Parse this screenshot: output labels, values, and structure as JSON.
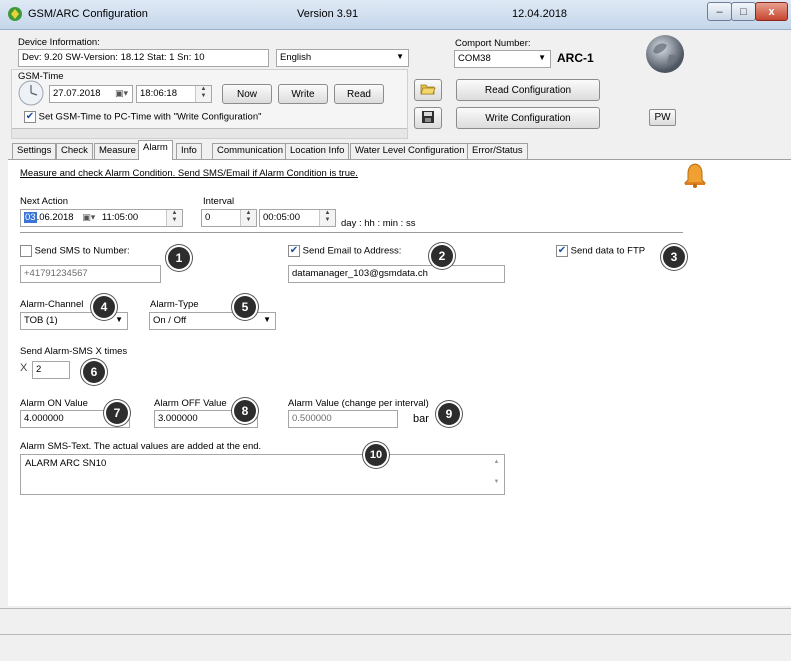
{
  "window": {
    "title": "GSM/ARC Configuration",
    "version": "Version 3.91",
    "date": "12.04.2018"
  },
  "device": {
    "label": "Device Information:",
    "info": "Dev: 9.20 SW-Version: 18.12 Stat: 1  Sn: 10",
    "language": "English"
  },
  "comport": {
    "label": "Comport Number:",
    "value": "COM38",
    "name": "ARC-1"
  },
  "gsm_time": {
    "label": "GSM-Time",
    "date": "27.07.2018",
    "time": "18:06:18",
    "now_label": "Now",
    "write_label": "Write",
    "read_label": "Read",
    "sync_label": "Set GSM-Time to PC-Time with \"Write Configuration\""
  },
  "config": {
    "read_label": "Read Configuration",
    "write_label": "Write Configuration",
    "pw_label": "PW"
  },
  "tabs": [
    {
      "label": "Settings"
    },
    {
      "label": "Check"
    },
    {
      "label": "Measure"
    },
    {
      "label": "Alarm"
    },
    {
      "label": "Info"
    },
    {
      "label": "Communication"
    },
    {
      "label": "Location Info"
    },
    {
      "label": "Water Level Configuration"
    },
    {
      "label": "Error/Status"
    }
  ],
  "alarm": {
    "description": "Measure and check Alarm Condition. Send SMS/Email if Alarm Condition is true.",
    "next_action_label": "Next Action",
    "next_action_day": "03",
    "next_action_date": ".06.2018",
    "next_action_time": "11:05:00",
    "interval_label": "Interval",
    "interval_days": "0",
    "interval_time": "00:05:00",
    "interval_format": "day : hh : min : ss",
    "sms_label": "Send SMS to Number:",
    "sms_number": "+41791234567",
    "email_label": "Send Email to Address:",
    "email_address": "datamanager_103@gsmdata.ch",
    "ftp_label": "Send data to FTP",
    "channel_label": "Alarm-Channel",
    "channel_value": "TOB (1)",
    "type_label": "Alarm-Type",
    "type_value": "On / Off",
    "repeat_label": "Send Alarm-SMS X times",
    "repeat_prefix": "X",
    "repeat_value": "2",
    "on_label": "Alarm ON Value",
    "on_value": "4.000000",
    "off_label": "Alarm OFF Value",
    "off_value": "3.000000",
    "delta_label": "Alarm Value (change per interval)",
    "delta_value": "0.500000",
    "unit": "bar",
    "sms_text_label": "Alarm SMS-Text. The actual values are added at the end.",
    "sms_text": "ALARM ARC SN10"
  },
  "badges": [
    "1",
    "2",
    "3",
    "4",
    "5",
    "6",
    "7",
    "8",
    "9",
    "10"
  ],
  "colors": {
    "badge": "#2d2d2d",
    "bell": "#f0a030",
    "checkmark": "#1d4fa3"
  }
}
